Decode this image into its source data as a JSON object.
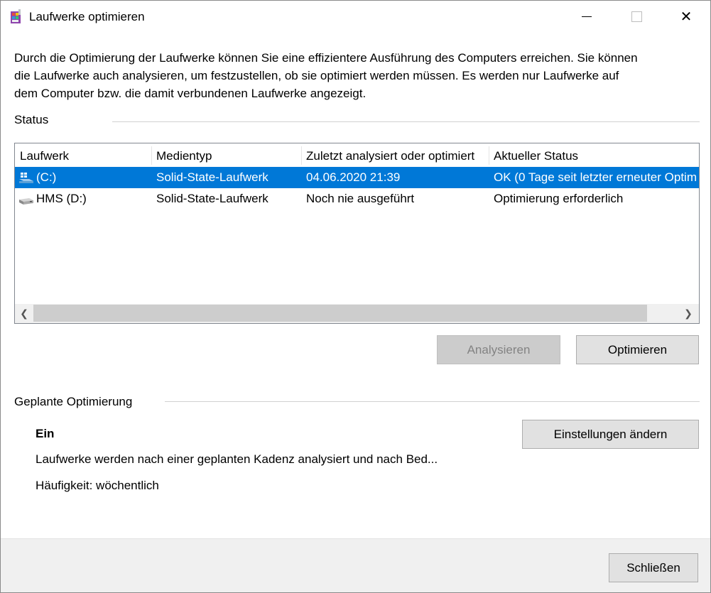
{
  "window": {
    "title": "Laufwerke optimieren",
    "description": "Durch die Optimierung der Laufwerke können Sie eine effizientere Ausführung des Computers erreichen. Sie können die Laufwerke auch analysieren, um festzustellen, ob sie optimiert werden müssen. Es werden nur Laufwerke auf dem Computer bzw. die damit verbundenen Laufwerke angezeigt.",
    "close_glyph": "✕"
  },
  "status": {
    "section_label": "Status",
    "columns": [
      "Laufwerk",
      "Medientyp",
      "Zuletzt analysiert oder optimiert",
      "Aktueller Status"
    ],
    "rows": [
      {
        "drive": "(C:)",
        "icon": "windows-drive-icon",
        "media": "Solid-State-Laufwerk",
        "last": "04.06.2020 21:39",
        "status": "OK (0 Tage seit letzter erneuter Optim",
        "selected": true
      },
      {
        "drive": "HMS (D:)",
        "icon": "drive-icon",
        "media": "Solid-State-Laufwerk",
        "last": "Noch nie ausgeführt",
        "status": "Optimierung erforderlich",
        "selected": false
      }
    ],
    "scroll_left": "❮",
    "scroll_right": "❯",
    "analyze_label": "Analysieren",
    "optimize_label": "Optimieren"
  },
  "schedule": {
    "section_label": "Geplante Optimierung",
    "state": "Ein",
    "description": "Laufwerke werden nach einer geplanten Kadenz analysiert und nach Bed...",
    "frequency": "Häufigkeit: wöchentlich",
    "change_settings_label": "Einstellungen ändern"
  },
  "footer": {
    "close_label": "Schließen"
  },
  "colors": {
    "selection": "#0078d7",
    "button_face": "#e1e1e1",
    "disabled_button": "#cccccc",
    "footer_bg": "#f0f0f0"
  }
}
